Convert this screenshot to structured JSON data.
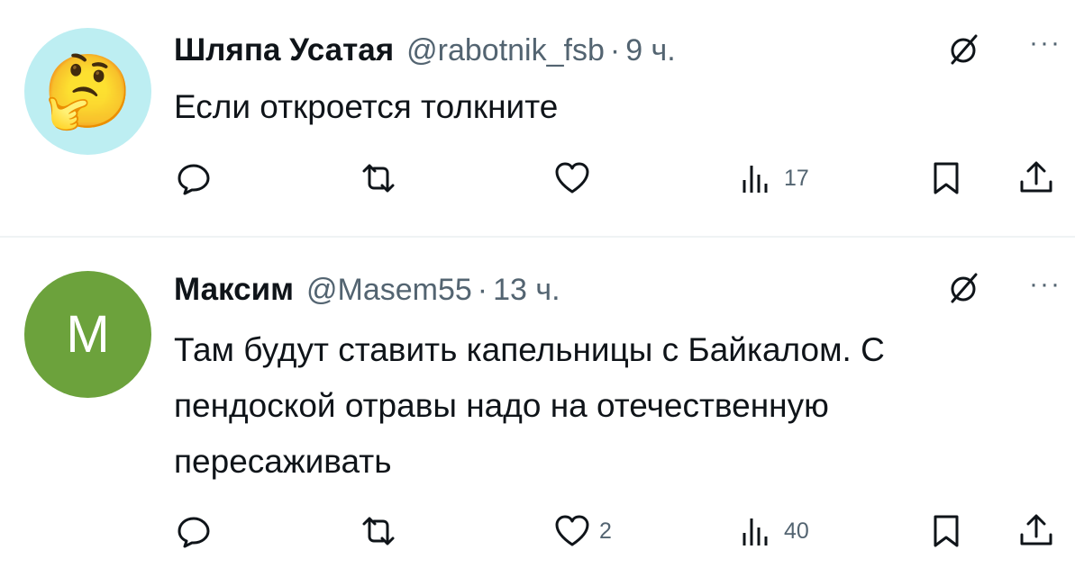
{
  "tweets": [
    {
      "name": "Шляпа Усатая",
      "handle": "@rabotnik_fsb",
      "separator": "·",
      "time": "9 ч.",
      "avatar_emoji": "🤔",
      "text": "Если откроется толкните",
      "views": "17",
      "likes": ""
    },
    {
      "name": "Максим",
      "handle": "@Masem55",
      "separator": "·",
      "time": "13 ч.",
      "avatar_letter": "M",
      "text": "Там будут ставить капельницы с Байкалом. С пендоской отравы надо на отечественную пересаживать",
      "views": "40",
      "likes": "2"
    }
  ],
  "more_glyph": "···",
  "colors": {
    "text": "#0f1419",
    "muted": "#536471",
    "avatar1_bg": "#bdeef2",
    "avatar2_bg": "#6ca23c",
    "divider": "#eff3f4"
  },
  "icons": [
    "reply-icon",
    "retweet-icon",
    "like-icon",
    "views-icon",
    "bookmark-icon",
    "share-icon",
    "grok-icon",
    "more-icon"
  ]
}
